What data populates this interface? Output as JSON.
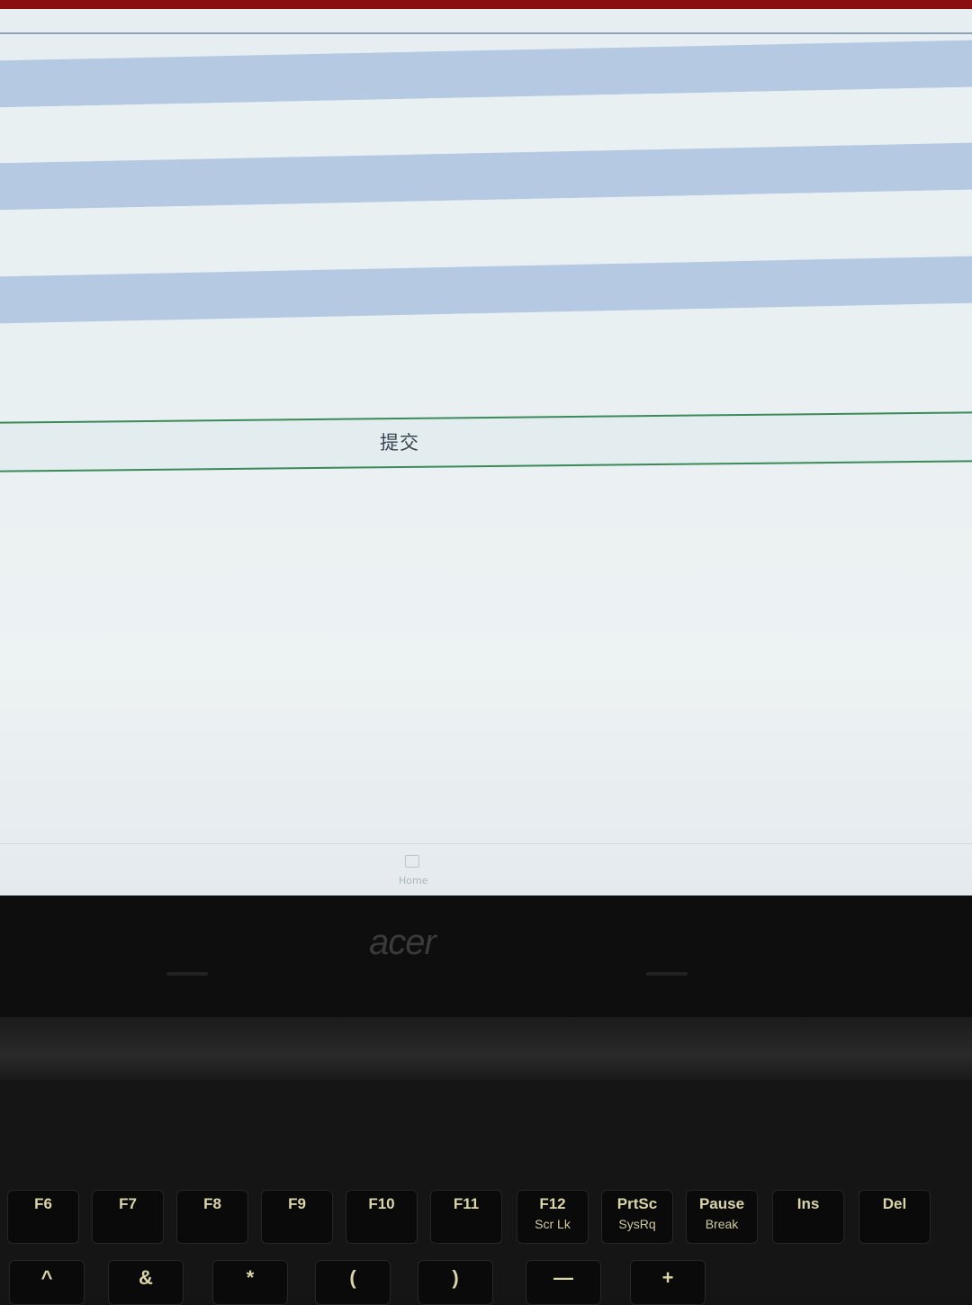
{
  "form": {
    "submit_label": "提交"
  },
  "nav": {
    "home_label": "Home",
    "home_icon": "home-icon"
  },
  "device": {
    "brand": "acer",
    "fn_keys": [
      {
        "label": "F6",
        "sub": ""
      },
      {
        "label": "F7",
        "sub": ""
      },
      {
        "label": "F8",
        "sub": ""
      },
      {
        "label": "F9",
        "sub": ""
      },
      {
        "label": "F10",
        "sub": ""
      },
      {
        "label": "F11",
        "sub": ""
      },
      {
        "label": "F12",
        "sub": "Scr Lk"
      },
      {
        "label": "PrtSc",
        "sub": "SysRq"
      },
      {
        "label": "Pause",
        "sub": "Break"
      },
      {
        "label": "Ins",
        "sub": ""
      },
      {
        "label": "Del",
        "sub": ""
      }
    ],
    "num_keys": [
      "^",
      "&",
      "*",
      "(",
      ")",
      "—",
      "+"
    ]
  }
}
